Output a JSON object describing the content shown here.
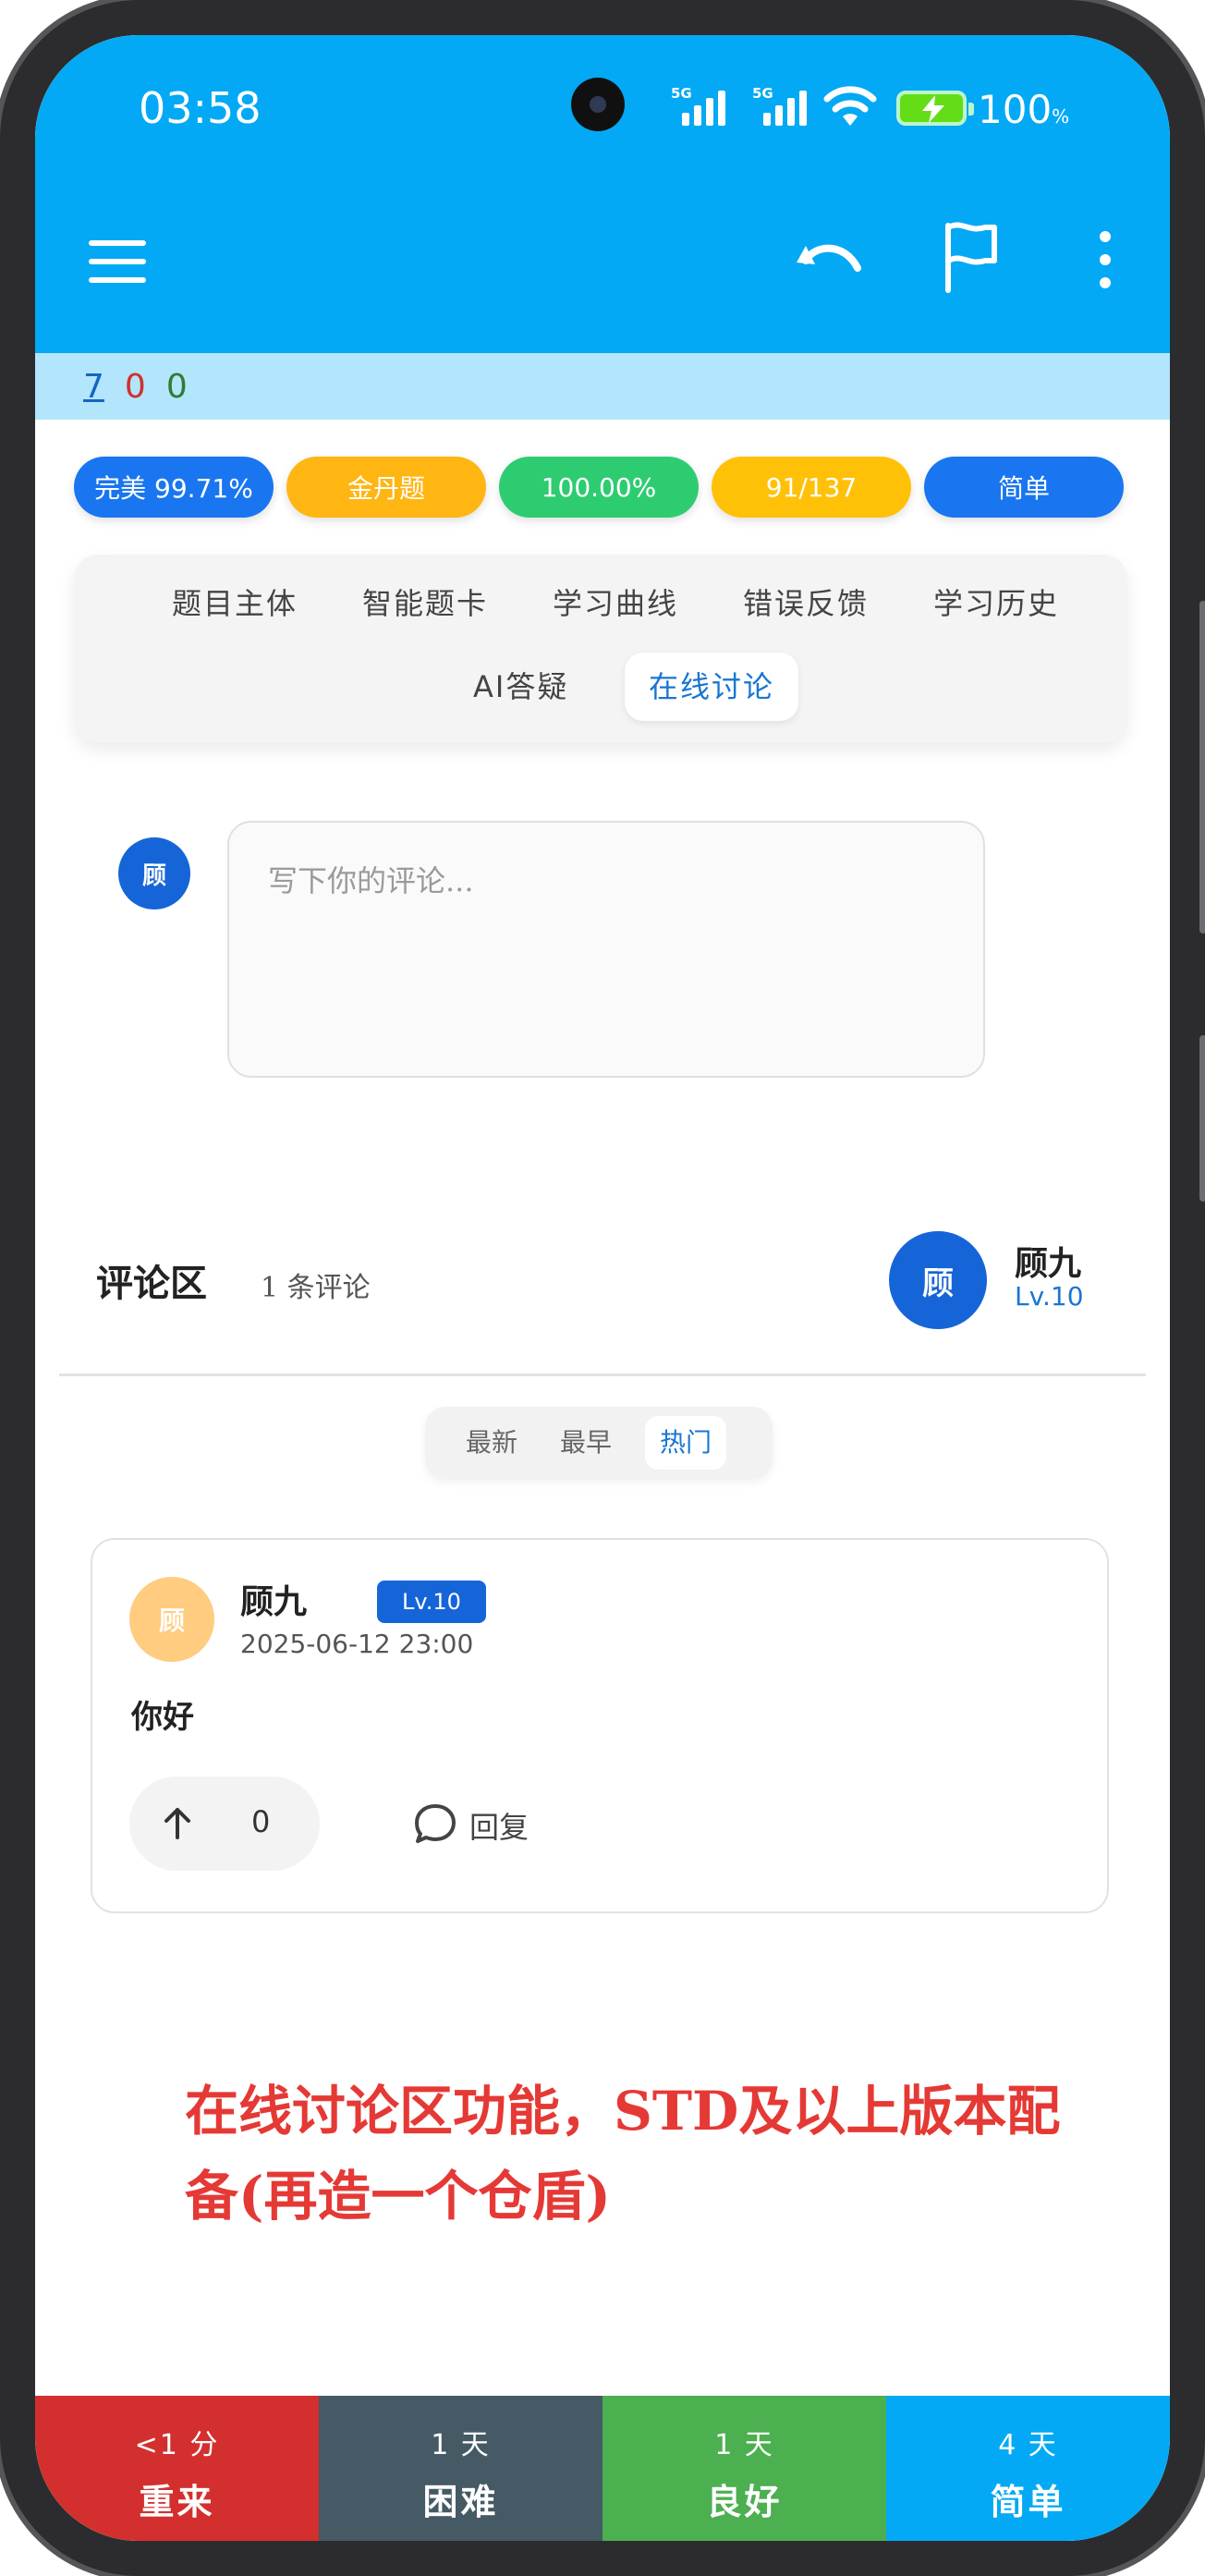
{
  "status_bar": {
    "time": "03:58",
    "network_1": "5G",
    "network_2": "5G",
    "battery": "100",
    "battery_unit": "%"
  },
  "toolbar": {
    "icons": [
      "menu-icon",
      "undo-icon",
      "flag-icon",
      "more-vert-icon"
    ]
  },
  "counts": {
    "a": "7",
    "b": "0",
    "c": "0"
  },
  "pills": [
    {
      "label": "完美 99.71%",
      "color": "#1976f0"
    },
    {
      "label": "金丹题",
      "color": "#ffb512"
    },
    {
      "label": "100.00%",
      "color": "#2ecc71"
    },
    {
      "label": "91/137",
      "color": "#ffc107"
    },
    {
      "label": "简单",
      "color": "#1976f0"
    }
  ],
  "tabs": [
    {
      "label": "题目主体",
      "active": false
    },
    {
      "label": "智能题卡",
      "active": false
    },
    {
      "label": "学习曲线",
      "active": false
    },
    {
      "label": "错误反馈",
      "active": false
    },
    {
      "label": "学习历史",
      "active": false
    },
    {
      "label": "AI答疑",
      "active": false
    },
    {
      "label": "在线讨论",
      "active": true
    }
  ],
  "composer": {
    "avatar_text": "顾",
    "placeholder": "写下你的评论..."
  },
  "comments_section": {
    "title": "评论区",
    "count_text": "1 条评论",
    "user": {
      "avatar_text": "顾",
      "name": "顾九",
      "level": "Lv.10"
    },
    "sort_options": [
      {
        "label": "最新",
        "active": false
      },
      {
        "label": "最早",
        "active": false
      },
      {
        "label": "热门",
        "active": true
      }
    ]
  },
  "comment": {
    "avatar_text": "顾",
    "name": "顾九",
    "level": "Lv.10",
    "time": "2025-06-12 23:00",
    "text": "你好",
    "likes": "0",
    "reply_label": "回复"
  },
  "annotation": "在线讨论区功能，STD及以上版本配备(再造一个仓盾)",
  "answer_buttons": [
    {
      "interval": "<1 分",
      "label": "重来",
      "color": "#d32f2f"
    },
    {
      "interval": "1 天",
      "label": "困难",
      "color": "#455a64"
    },
    {
      "interval": "1 天",
      "label": "良好",
      "color": "#4caf50"
    },
    {
      "interval": "4 天",
      "label": "简单",
      "color": "#03a9f4"
    }
  ]
}
